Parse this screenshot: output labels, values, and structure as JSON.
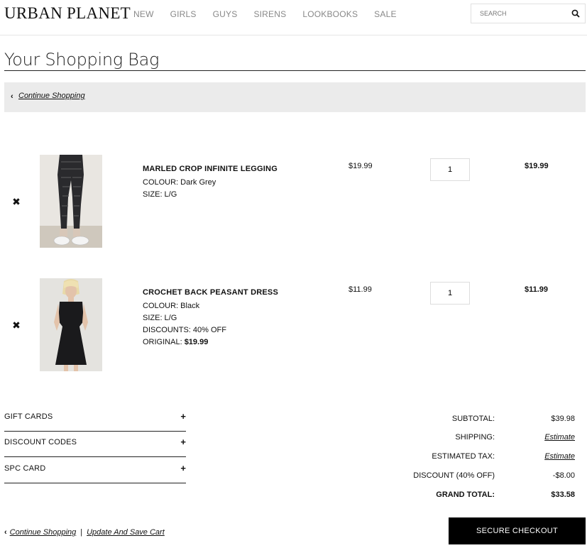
{
  "header": {
    "logo": "URBAN PLANET",
    "nav": [
      "NEW",
      "GIRLS",
      "GUYS",
      "SIRENS",
      "LOOKBOOKS",
      "SALE"
    ],
    "search_placeholder": "SEARCH"
  },
  "page": {
    "title": "Your Shopping Bag",
    "continue_shopping": "Continue Shopping"
  },
  "items": [
    {
      "name": "MARLED CROP INFINITE LEGGING",
      "colour": "COLOUR: Dark Grey",
      "size": "SIZE: L/G",
      "price": "$19.99",
      "qty": "1",
      "total": "$19.99",
      "image_icon": "legging-product-photo"
    },
    {
      "name": "CROCHET BACK PEASANT DRESS",
      "colour": "COLOUR: Black",
      "size": "SIZE: L/G",
      "discounts": "DISCOUNTS: 40% OFF",
      "original_label": "ORIGINAL:",
      "original_value": "$19.99",
      "price": "$11.99",
      "qty": "1",
      "total": "$11.99",
      "image_icon": "dress-product-photo"
    }
  ],
  "accordions": [
    "GIFT CARDS",
    "DISCOUNT CODES",
    "SPC CARD"
  ],
  "summary": {
    "subtotal_label": "SUBTOTAL:",
    "subtotal_value": "$39.98",
    "shipping_label": "SHIPPING:",
    "shipping_value": "Estimate",
    "tax_label": "ESTIMATED TAX:",
    "tax_value": "Estimate",
    "discount_label": "DISCOUNT (40% OFF)",
    "discount_value": "-$8.00",
    "grand_label": "GRAND TOTAL:",
    "grand_value": "$33.58"
  },
  "footer": {
    "continue_shopping": "Continue Shopping",
    "separator": "|",
    "update_cart": "Update And Save Cart",
    "checkout": "SECURE CHECKOUT"
  },
  "colors": {
    "accent": "#000000",
    "nav_text": "#888888",
    "bar_bg": "#ebebeb"
  }
}
